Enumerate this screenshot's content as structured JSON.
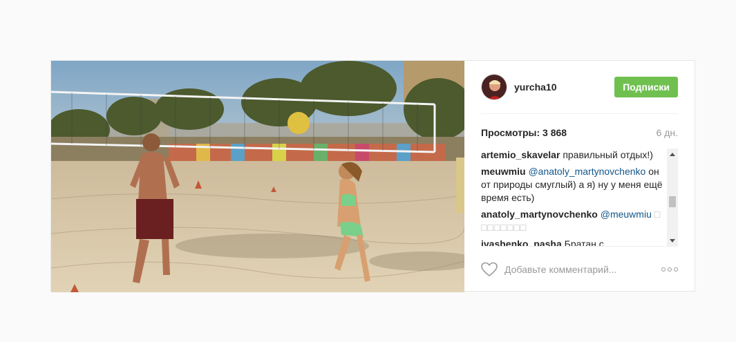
{
  "post": {
    "username": "yurcha10",
    "follow_label": "Подписки",
    "views": "Просмотры: 3 868",
    "time": "6 дн.",
    "comments": [
      {
        "author": "artemio_skavelar",
        "text": "правильный отдых!)"
      },
      {
        "author": "meuwmiu",
        "mention": "@anatoly_martynovchenko",
        "text": "он от природы смуглый) а я) ну у меня ещё время есть)"
      },
      {
        "author": "anatoly_martynovchenko",
        "mention": "@meuwmiu",
        "tofu": "□ □□□□□□□"
      },
      {
        "author": "ivashenko_pasha",
        "text": "Братан с"
      }
    ],
    "comment_placeholder": "Добавьте комментарий...",
    "icons": {
      "like": "heart-icon",
      "more": "more-options-icon"
    },
    "colors": {
      "follow_bg": "#70c050",
      "mention": "#125688"
    }
  }
}
